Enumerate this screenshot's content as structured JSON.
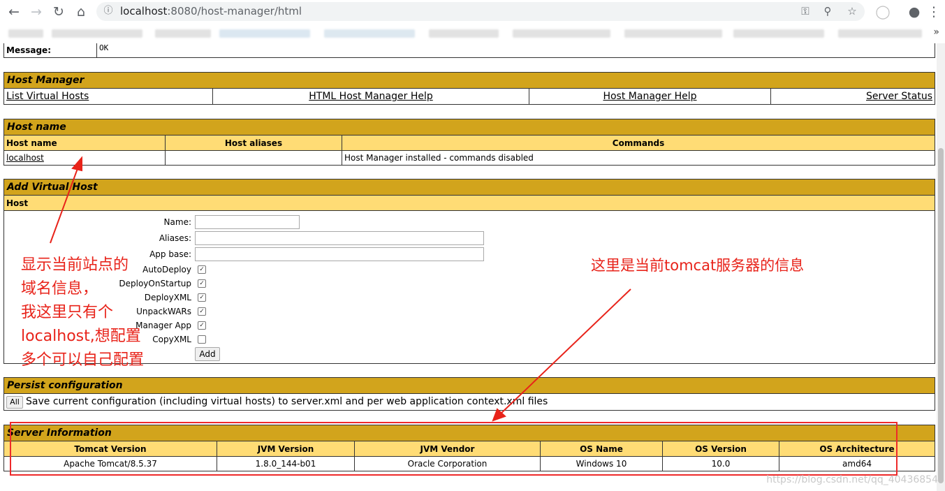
{
  "browser": {
    "url_host": "localhost",
    "url_rest": ":8080/host-manager/html"
  },
  "message": {
    "label": "Message:",
    "value": "OK"
  },
  "host_manager": {
    "title": "Host Manager",
    "links": [
      "List Virtual Hosts",
      "HTML Host Manager Help",
      "Host Manager Help",
      "Server Status"
    ]
  },
  "host_name": {
    "title": "Host name",
    "columns": [
      "Host name",
      "Host aliases",
      "Commands"
    ],
    "row": {
      "name": "localhost",
      "aliases": "",
      "commands": "Host Manager installed - commands disabled"
    }
  },
  "add_virtual_host": {
    "title": "Add Virtual Host",
    "subheader": "Host",
    "fields": {
      "name": "Name:",
      "aliases": "Aliases:",
      "app_base": "App base:"
    },
    "checkboxes": [
      {
        "label": "AutoDeploy",
        "checked": true
      },
      {
        "label": "DeployOnStartup",
        "checked": true
      },
      {
        "label": "DeployXML",
        "checked": true
      },
      {
        "label": "UnpackWARs",
        "checked": true
      },
      {
        "label": "Manager App",
        "checked": true
      },
      {
        "label": "CopyXML",
        "checked": false
      }
    ],
    "add_button": "Add"
  },
  "persist": {
    "title": "Persist configuration",
    "button": "All",
    "description": "Save current configuration (including virtual hosts) to server.xml and per web application context.xml files"
  },
  "server_info": {
    "title": "Server Information",
    "columns": [
      "Tomcat Version",
      "JVM Version",
      "JVM Vendor",
      "OS Name",
      "OS Version",
      "OS Architecture"
    ],
    "values": [
      "Apache Tomcat/8.5.37",
      "1.8.0_144-b01",
      "Oracle Corporation",
      "Windows 10",
      "10.0",
      "amd64"
    ]
  },
  "annotations": {
    "left_lines": [
      "显示当前站点的",
      "域名信息，",
      "我这里只有个",
      "localhost,想配置",
      "多个可以自己配置"
    ],
    "right": "这里是当前tomcat服务器的信息",
    "color": "#e8231a"
  },
  "watermark": "https://blog.csdn.net/qq_40436854"
}
